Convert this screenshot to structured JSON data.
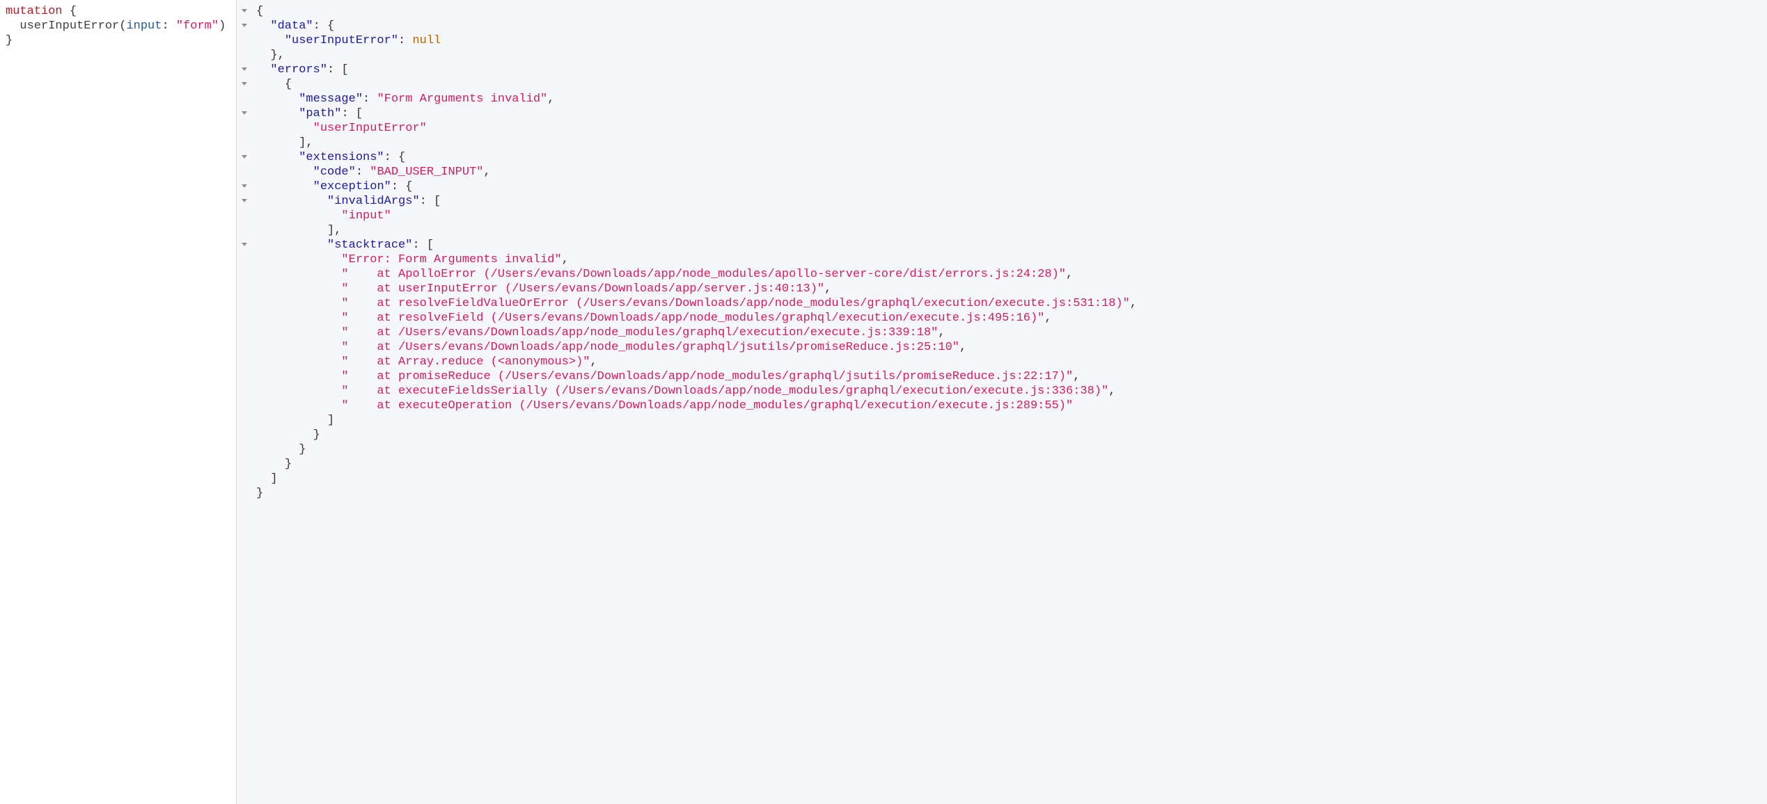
{
  "query": {
    "line1_kw": "mutation",
    "line1_brace": " {",
    "line2_indent": "  ",
    "line2_fn": "userInputError",
    "line2_open": "(",
    "line2_arg": "input",
    "line2_colon": ": ",
    "line2_str": "\"form\"",
    "line2_close": ")",
    "line3": "}"
  },
  "gutter": {
    "l1": "▾",
    "l2": "",
    "l3": "▾",
    "l4": "",
    "l5": "",
    "l6": "▾",
    "l7": "▾",
    "l8": "",
    "l9": "",
    "l10": "",
    "l11": "",
    "l12": "▾",
    "l13": "",
    "l14": "▾",
    "l15": "",
    "l16": "",
    "l17": "",
    "l18": "▾"
  },
  "response": {
    "lines": [
      {
        "i": 0,
        "t": [
          {
            "c": "punct",
            "v": "{"
          }
        ]
      },
      {
        "i": 1,
        "t": [
          {
            "c": "key",
            "v": "\"data\""
          },
          {
            "c": "punct",
            "v": ": {"
          }
        ]
      },
      {
        "i": 2,
        "t": [
          {
            "c": "key",
            "v": "\"userInputError\""
          },
          {
            "c": "punct",
            "v": ": "
          },
          {
            "c": "null",
            "v": "null"
          }
        ]
      },
      {
        "i": 1,
        "t": [
          {
            "c": "punct",
            "v": "},"
          }
        ]
      },
      {
        "i": 1,
        "t": [
          {
            "c": "key",
            "v": "\"errors\""
          },
          {
            "c": "punct",
            "v": ": ["
          }
        ]
      },
      {
        "i": 2,
        "t": [
          {
            "c": "punct",
            "v": "{"
          }
        ]
      },
      {
        "i": 3,
        "t": [
          {
            "c": "key",
            "v": "\"message\""
          },
          {
            "c": "punct",
            "v": ": "
          },
          {
            "c": "val-str",
            "v": "\"Form Arguments invalid\""
          },
          {
            "c": "punct",
            "v": ","
          }
        ]
      },
      {
        "i": 3,
        "t": [
          {
            "c": "key",
            "v": "\"path\""
          },
          {
            "c": "punct",
            "v": ": ["
          }
        ]
      },
      {
        "i": 4,
        "t": [
          {
            "c": "val-str",
            "v": "\"userInputError\""
          }
        ]
      },
      {
        "i": 3,
        "t": [
          {
            "c": "punct",
            "v": "],"
          }
        ]
      },
      {
        "i": 3,
        "t": [
          {
            "c": "key",
            "v": "\"extensions\""
          },
          {
            "c": "punct",
            "v": ": {"
          }
        ]
      },
      {
        "i": 4,
        "t": [
          {
            "c": "key",
            "v": "\"code\""
          },
          {
            "c": "punct",
            "v": ": "
          },
          {
            "c": "val-str",
            "v": "\"BAD_USER_INPUT\""
          },
          {
            "c": "punct",
            "v": ","
          }
        ]
      },
      {
        "i": 4,
        "t": [
          {
            "c": "key",
            "v": "\"exception\""
          },
          {
            "c": "punct",
            "v": ": {"
          }
        ]
      },
      {
        "i": 5,
        "t": [
          {
            "c": "key",
            "v": "\"invalidArgs\""
          },
          {
            "c": "punct",
            "v": ": ["
          }
        ]
      },
      {
        "i": 6,
        "t": [
          {
            "c": "val-str",
            "v": "\"input\""
          }
        ]
      },
      {
        "i": 5,
        "t": [
          {
            "c": "punct",
            "v": "],"
          }
        ]
      },
      {
        "i": 5,
        "t": [
          {
            "c": "key",
            "v": "\"stacktrace\""
          },
          {
            "c": "punct",
            "v": ": ["
          }
        ]
      },
      {
        "i": 6,
        "t": [
          {
            "c": "val-str",
            "v": "\"Error: Form Arguments invalid\""
          },
          {
            "c": "punct",
            "v": ","
          }
        ]
      },
      {
        "i": 6,
        "t": [
          {
            "c": "val-str",
            "v": "\"    at ApolloError (/Users/evans/Downloads/app/node_modules/apollo-server-core/dist/errors.js:24:28)\""
          },
          {
            "c": "punct",
            "v": ","
          }
        ]
      },
      {
        "i": 6,
        "t": [
          {
            "c": "val-str",
            "v": "\"    at userInputError (/Users/evans/Downloads/app/server.js:40:13)\""
          },
          {
            "c": "punct",
            "v": ","
          }
        ]
      },
      {
        "i": 6,
        "t": [
          {
            "c": "val-str",
            "v": "\"    at resolveFieldValueOrError (/Users/evans/Downloads/app/node_modules/graphql/execution/execute.js:531:18)\""
          },
          {
            "c": "punct",
            "v": ","
          }
        ]
      },
      {
        "i": 6,
        "t": [
          {
            "c": "val-str",
            "v": "\"    at resolveField (/Users/evans/Downloads/app/node_modules/graphql/execution/execute.js:495:16)\""
          },
          {
            "c": "punct",
            "v": ","
          }
        ]
      },
      {
        "i": 6,
        "t": [
          {
            "c": "val-str",
            "v": "\"    at /Users/evans/Downloads/app/node_modules/graphql/execution/execute.js:339:18\""
          },
          {
            "c": "punct",
            "v": ","
          }
        ]
      },
      {
        "i": 6,
        "t": [
          {
            "c": "val-str",
            "v": "\"    at /Users/evans/Downloads/app/node_modules/graphql/jsutils/promiseReduce.js:25:10\""
          },
          {
            "c": "punct",
            "v": ","
          }
        ]
      },
      {
        "i": 6,
        "t": [
          {
            "c": "val-str",
            "v": "\"    at Array.reduce (<anonymous>)\""
          },
          {
            "c": "punct",
            "v": ","
          }
        ]
      },
      {
        "i": 6,
        "t": [
          {
            "c": "val-str",
            "v": "\"    at promiseReduce (/Users/evans/Downloads/app/node_modules/graphql/jsutils/promiseReduce.js:22:17)\""
          },
          {
            "c": "punct",
            "v": ","
          }
        ]
      },
      {
        "i": 6,
        "t": [
          {
            "c": "val-str",
            "v": "\"    at executeFieldsSerially (/Users/evans/Downloads/app/node_modules/graphql/execution/execute.js:336:38)\""
          },
          {
            "c": "punct",
            "v": ","
          }
        ]
      },
      {
        "i": 6,
        "t": [
          {
            "c": "val-str",
            "v": "\"    at executeOperation (/Users/evans/Downloads/app/node_modules/graphql/execution/execute.js:289:55)\""
          }
        ]
      },
      {
        "i": 5,
        "t": [
          {
            "c": "punct",
            "v": "]"
          }
        ]
      },
      {
        "i": 4,
        "t": [
          {
            "c": "punct",
            "v": "}"
          }
        ]
      },
      {
        "i": 3,
        "t": [
          {
            "c": "punct",
            "v": "}"
          }
        ]
      },
      {
        "i": 2,
        "t": [
          {
            "c": "punct",
            "v": "}"
          }
        ]
      },
      {
        "i": 1,
        "t": [
          {
            "c": "punct",
            "v": "]"
          }
        ]
      },
      {
        "i": 0,
        "t": [
          {
            "c": "punct",
            "v": "}"
          }
        ]
      }
    ]
  }
}
